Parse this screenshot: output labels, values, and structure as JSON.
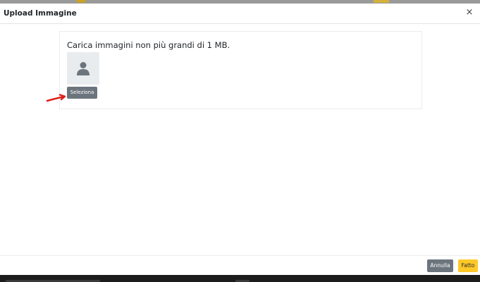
{
  "header": {
    "title": "Upload Immagine",
    "close_icon": "close-icon",
    "close_glyph": "×"
  },
  "card": {
    "instruction": "Carica immagini non più grandi di 1 MB.",
    "avatar_icon": "user-placeholder-icon",
    "select_label": "Seleziona"
  },
  "annotation": {
    "icon": "red-arrow-annotation",
    "color": "#e0201c"
  },
  "footer": {
    "cancel_label": "Annulla",
    "done_label": "Fatto"
  },
  "colors": {
    "secondary": "#6c757d",
    "accent": "#ffc928",
    "avatar_bg": "#e9ecef"
  }
}
